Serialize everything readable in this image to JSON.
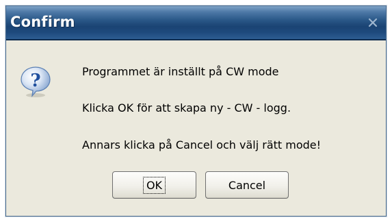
{
  "dialog": {
    "title": "Confirm",
    "close_icon": "close-icon",
    "message_icon": "question-icon",
    "lines": [
      "Programmet är inställt på CW mode",
      "Klicka OK för att skapa ny - CW - logg.",
      "Annars klicka på Cancel och välj rätt mode!"
    ],
    "buttons": {
      "ok_label": "OK",
      "cancel_label": "Cancel"
    },
    "colors": {
      "titlebar": "#1e4a7d",
      "body": "#ebe9dd",
      "icon_blue": "#2f63b3"
    }
  }
}
